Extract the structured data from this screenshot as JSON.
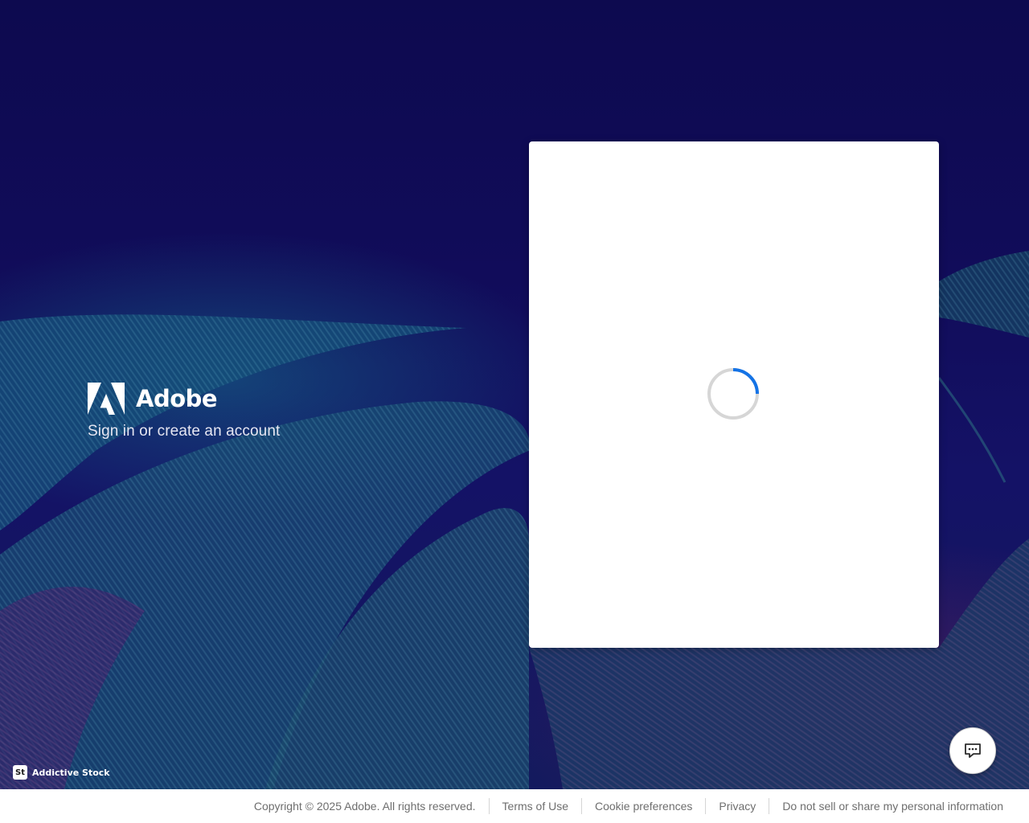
{
  "brand": {
    "name": "Adobe",
    "tagline": "Sign in or create an account",
    "logo_icon": "adobe-logo-icon"
  },
  "signin_card": {
    "state": "loading",
    "spinner_icon": "loading-spinner-icon",
    "spinner_color": "#1473e6"
  },
  "attribution": {
    "badge": "St",
    "text": "Addictive Stock"
  },
  "chat": {
    "icon": "chat-bubble-icon"
  },
  "footer": {
    "copyright": "Copyright © 2025 Adobe. All rights reserved.",
    "links": [
      {
        "label": "Terms of Use"
      },
      {
        "label": "Cookie preferences"
      },
      {
        "label": "Privacy"
      },
      {
        "label": "Do not sell or share my personal information"
      }
    ]
  },
  "colors": {
    "background": "#110c5a",
    "card": "#ffffff",
    "accent": "#1473e6",
    "footer_text": "#6e6e6e"
  }
}
